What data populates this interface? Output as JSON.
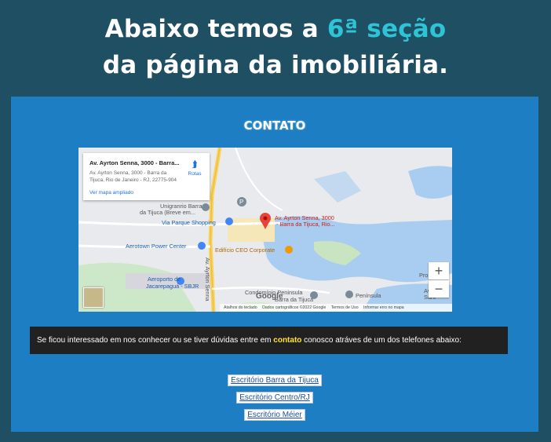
{
  "headline": {
    "part1": "Abaixo temos a ",
    "accent": "6ª seção",
    "line2": "da página da imobiliária."
  },
  "section": {
    "title": "CONTATO"
  },
  "map": {
    "card_title": "Av. Ayrton Senna, 3000 - Barra...",
    "card_address": "Av. Ayrton Senna, 3000 - Barra da Tijuca, Rio de Janeiro - RJ, 22775-904",
    "card_link": "Ver mapa ampliado",
    "directions_label": "Rotas",
    "labels": {
      "unigranrio": "Unigranrio Barra",
      "unigranrio2": "da Tijuca (Breve em...",
      "via_parque": "Via Parque Shopping",
      "aerotown": "Aerotown Power Center",
      "edificio": "Edifício CEO Corporate",
      "aeroporto": "Aeroporto de",
      "aeroporto2": "Jacarepaguá - SBJR",
      "ayrton_road": "Av. Ayrton Senna",
      "pin_label1": "Av. Ayrton Senna, 3000",
      "pin_label2": "- Barra da Tijuca, Rio...",
      "condominio": "Condomínio Peninsula",
      "barra": "Barra da Tijuca",
      "peninsula": "Península",
      "pro": "Pro",
      "av": "Av.",
      "sant": "Sant"
    },
    "zoom_in": "+",
    "zoom_out": "−",
    "logo": "Google",
    "attribution": [
      "Atalhos do teclado",
      "Dados cartográficos ©2022 Google",
      "Termos de Uso",
      "Informar erro no mapa"
    ]
  },
  "message": {
    "before": "Se ficou interessado em nos conhecer ou se tiver dúvidas entre em ",
    "highlight": "contato",
    "after": " conosco atráves de um dos telefones abaixo:"
  },
  "offices": [
    "Escritório Barra da Tijuca",
    "Escritório Centro/RJ",
    "Escritório Méier"
  ],
  "colors": {
    "background": "#1f4f63",
    "panel": "#1e7ec4",
    "accent": "#2ec4d6",
    "highlight": "#ffe342"
  }
}
